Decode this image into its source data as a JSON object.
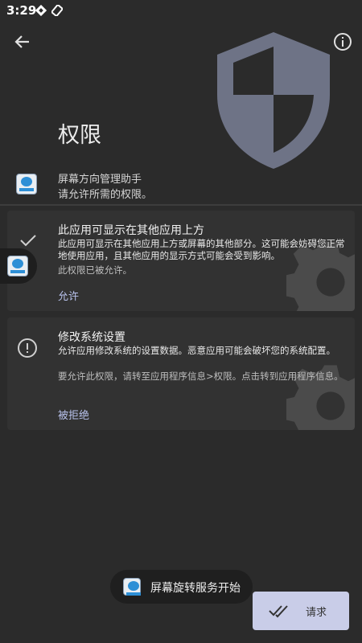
{
  "status_bar": {
    "time": "3:29",
    "icons": [
      "notification-icon",
      "signal-icon"
    ]
  },
  "header": {
    "title": "权限",
    "back_icon": "arrow-back-icon",
    "info_icon": "info-icon",
    "shield_icon": "shield-icon"
  },
  "app": {
    "name": "屏幕方向管理助手",
    "subtitle": "请允许所需的权限。",
    "icon": "app-icon"
  },
  "permissions": [
    {
      "title": "此应用可显示在其他应用上方",
      "description": "此应用可显示在其他应用上方或屏幕的其他部分。这可能会妨碍您正常地使用应用，且其他应用的显示方式可能会受到影响。",
      "status": "此权限已被允许。",
      "action": "允许",
      "icon": "check-icon"
    },
    {
      "title": "修改系统设置",
      "description": "允许应用修改系统的设置数据。恶意应用可能会破坏您的系统配置。",
      "status": "要允许此权限，请转至应用程序信息>权限。点击转到应用程序信息。",
      "action": "被拒绝",
      "icon": "alert-icon"
    }
  ],
  "toast": {
    "text": "屏幕旋转服务开始"
  },
  "fab": {
    "label": "请求",
    "icon": "done-all-icon"
  },
  "colors": {
    "background": "#2b2b2b",
    "card": "#323232",
    "accent": "#b8c2ec",
    "fab": "#c9cde8"
  }
}
